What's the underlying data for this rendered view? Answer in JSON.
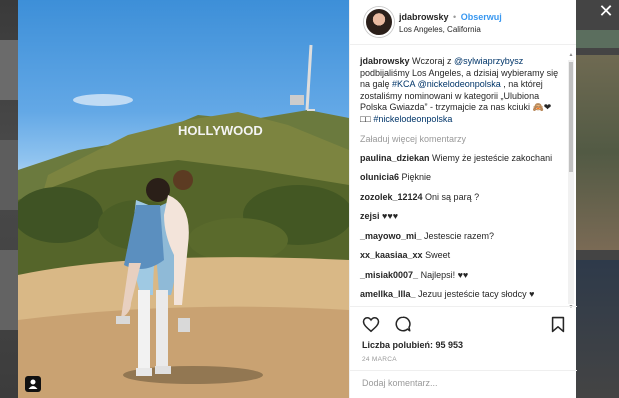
{
  "post": {
    "username": "jdabrowsky",
    "separator": "•",
    "follow_label": "Obserwuj",
    "location": "Los Angeles, California",
    "caption": {
      "username": "jdabrowsky",
      "text_1": " Wczoraj z ",
      "mention_1": "@sylwiaprzybysz",
      "text_2": " podbijaliśmy Los Angeles, a dzisiaj wybieramy się na galę ",
      "hashtag_1": "#KCA",
      "text_3": " ",
      "mention_2": "@nickelodeonpolska",
      "text_4": " , na której zostaliśmy nominowani w kategorii „Ulubiona Polska Gwiazda” - trzymajcie za nas kciuki 🙈❤□□ ",
      "hashtag_2": "#nickelodeonpolska"
    },
    "load_more_label": "Załaduj więcej komentarzy",
    "comments": [
      {
        "user": "paulina_dziekan",
        "text": " Wiemy że jesteście zakochani"
      },
      {
        "user": "olunicia6",
        "text": " Pięknie"
      },
      {
        "user": "zozolek_12124",
        "text": " Oni są parą ?"
      },
      {
        "user": "zejsi",
        "text": " ♥♥♥"
      },
      {
        "user": "_mayowo_mi_",
        "text": " Jestescie razem?"
      },
      {
        "user": "xx_kaasiaa_xx",
        "text": " Sweet"
      },
      {
        "user": "_misiak0007_",
        "text": " Najlepsi! ♥♥"
      },
      {
        "user": "amellka_llla_",
        "text": " Jezuu jesteście tacy słodcy ♥"
      }
    ],
    "likes_label": "Liczba polubień: 95 953",
    "date": "24 MARCA",
    "add_comment_placeholder": "Dodaj komentarz...",
    "photo_sign_text": "HOLLYWOOD"
  },
  "icons": {
    "like": "heart-icon",
    "comment": "comment-bubble-icon",
    "save": "bookmark-icon",
    "close": "close-icon",
    "tag": "user-tag-icon"
  },
  "colors": {
    "link": "#003569",
    "follow": "#3897f0",
    "muted": "#999999"
  }
}
